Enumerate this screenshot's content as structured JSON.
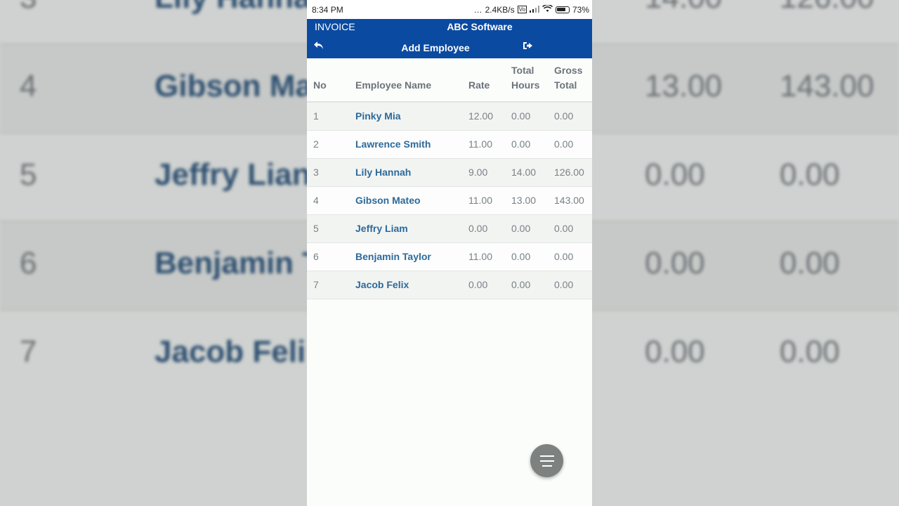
{
  "status_bar": {
    "time": "8:34 PM",
    "network_speed": "2.4KB/s",
    "battery": "73%"
  },
  "app_bar": {
    "left_label": "INVOICE",
    "title": "ABC Software",
    "subtitle": "Add Employee",
    "back_icon": "reply-arrow-icon",
    "logout_icon": "sign-out-icon"
  },
  "table": {
    "headers": {
      "no": "No",
      "name": "Employee Name",
      "rate": "Rate",
      "hours_1": "Total",
      "hours_2": "Hours",
      "gross_1": "Gross",
      "gross_2": "Total"
    },
    "rows": [
      {
        "no": "1",
        "name": "Pinky Mia",
        "rate": "12.00",
        "hours": "0.00",
        "gross": "0.00"
      },
      {
        "no": "2",
        "name": "Lawrence Smith",
        "rate": "11.00",
        "hours": "0.00",
        "gross": "0.00"
      },
      {
        "no": "3",
        "name": "Lily Hannah",
        "rate": "9.00",
        "hours": "14.00",
        "gross": "126.00"
      },
      {
        "no": "4",
        "name": "Gibson Mateo",
        "rate": "11.00",
        "hours": "13.00",
        "gross": "143.00"
      },
      {
        "no": "5",
        "name": "Jeffry Liam",
        "rate": "0.00",
        "hours": "0.00",
        "gross": "0.00"
      },
      {
        "no": "6",
        "name": "Benjamin Taylor",
        "rate": "11.00",
        "hours": "0.00",
        "gross": "0.00"
      },
      {
        "no": "7",
        "name": "Jacob Felix",
        "rate": "0.00",
        "hours": "0.00",
        "gross": "0.00"
      }
    ]
  },
  "fab": {
    "icon": "menu-lines-icon"
  },
  "backdrop": {
    "rows": [
      {
        "no": "3",
        "name": "Lily Hanna",
        "v1": "14.00",
        "v2": "126.00"
      },
      {
        "no": "4",
        "name": "Gibson Ma",
        "v1": "13.00",
        "v2": "143.00"
      },
      {
        "no": "5",
        "name": "Jeffry Lian",
        "v1": "0.00",
        "v2": "0.00"
      },
      {
        "no": "6",
        "name": "Benjamin T",
        "v1": "0.00",
        "v2": "0.00"
      },
      {
        "no": "7",
        "name": "Jacob Feli",
        "v1": "0.00",
        "v2": "0.00"
      }
    ]
  }
}
